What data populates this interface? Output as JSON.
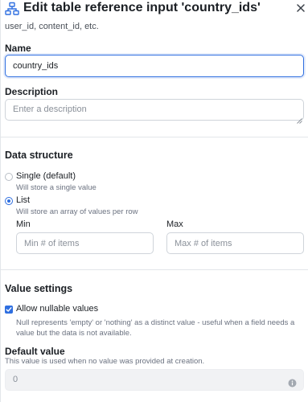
{
  "header": {
    "title": "Edit table reference input 'country_ids'",
    "icon": "table-hierarchy-icon",
    "close_icon": "close-icon"
  },
  "subtitle": "user_id, content_id, etc.",
  "name_field": {
    "label": "Name",
    "value": "country_ids"
  },
  "description_field": {
    "label": "Description",
    "placeholder": "Enter a description"
  },
  "data_structure": {
    "title": "Data structure",
    "options": [
      {
        "label": "Single (default)",
        "help": "Will store a single value",
        "selected": false
      },
      {
        "label": "List",
        "help": "Will store an array of values per row",
        "selected": true
      }
    ],
    "min": {
      "label": "Min",
      "placeholder": "Min # of items"
    },
    "max": {
      "label": "Max",
      "placeholder": "Max # of items"
    }
  },
  "value_settings": {
    "title": "Value settings",
    "nullable": {
      "label": "Allow nullable values",
      "checked": true,
      "help": "Null represents 'empty' or 'nothing' as a distinct value - useful when a field needs a value but the data is not available."
    },
    "default_value": {
      "label": "Default value",
      "help": "This value is used when no value was provided at creation.",
      "value": "0"
    }
  },
  "colors": {
    "accent": "#2f6fe0",
    "text": "#1b1f24",
    "muted": "#6b7280",
    "border": "#cfd4da",
    "disabled_bg": "#f1f2f4"
  }
}
